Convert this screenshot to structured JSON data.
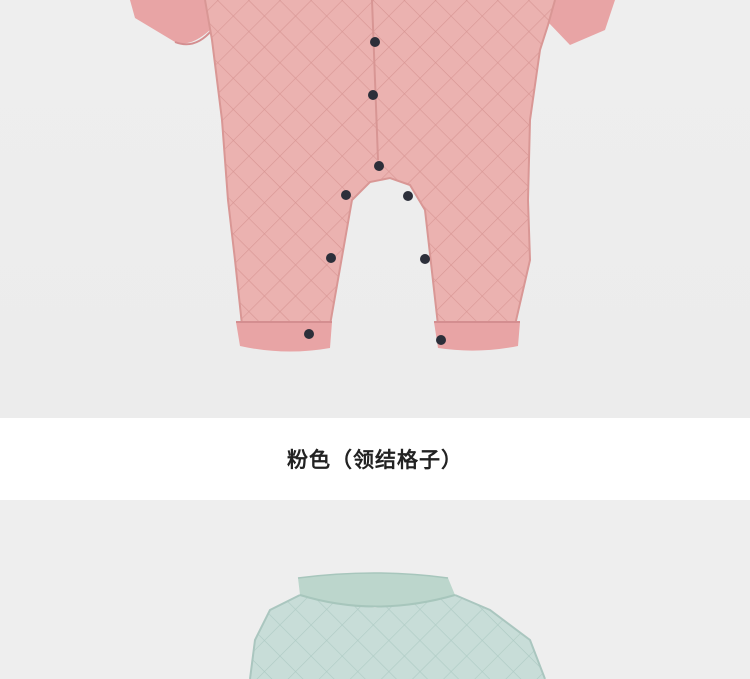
{
  "caption": "粉色（领结格子）",
  "colors": {
    "background": "#eeeeee",
    "pink_fabric": "#eab0ad",
    "pink_cuff": "#e8a4a5",
    "mint_fabric": "#c6dcd6",
    "mint_collar": "#bcd6cc",
    "snap_button": "#2c2f3a"
  },
  "images": [
    {
      "name": "pink-quilted-romper",
      "description_color": "pink"
    },
    {
      "name": "mint-quilted-romper",
      "description_color": "mint"
    }
  ]
}
